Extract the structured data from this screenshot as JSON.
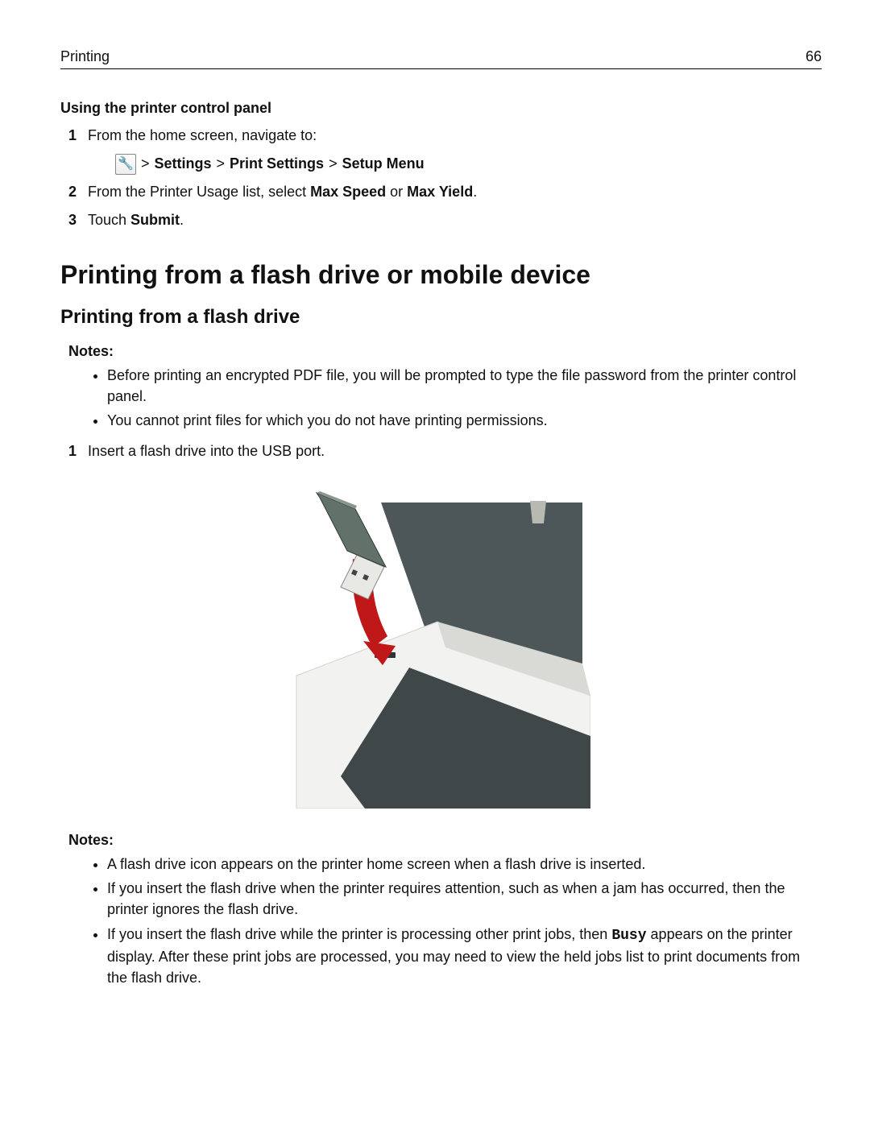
{
  "header": {
    "section": "Printing",
    "page_number": "66"
  },
  "section1": {
    "title": "Using the printer control panel",
    "step1": "From the home screen, navigate to:",
    "breadcrumb_gt1": ">",
    "breadcrumb_b1": "Settings",
    "breadcrumb_gt2": ">",
    "breadcrumb_b2": "Print Settings",
    "breadcrumb_gt3": ">",
    "breadcrumb_b3": "Setup Menu",
    "step2_pre": "From the Printer Usage list, select ",
    "step2_b1": "Max Speed",
    "step2_mid": " or ",
    "step2_b2": "Max Yield",
    "step2_post": ".",
    "step3_pre": "Touch ",
    "step3_b": "Submit",
    "step3_post": "."
  },
  "h1": "Printing from a flash drive or mobile device",
  "h2": "Printing from a flash drive",
  "notes1": {
    "label": "Notes:",
    "b1": "Before printing an encrypted PDF file, you will be prompted to type the file password from the printer control panel.",
    "b2": "You cannot print files for which you do not have printing permissions."
  },
  "step_flash": "Insert a flash drive into the USB port.",
  "notes2": {
    "label": "Notes:",
    "b1": "A flash drive icon appears on the printer home screen when a flash drive is inserted.",
    "b2": "If you insert the flash drive when the printer requires attention, such as when a jam has occurred, then the printer ignores the flash drive.",
    "b3_pre": "If you insert the flash drive while the printer is processing other print jobs, then ",
    "b3_busy": "Busy",
    "b3_post": " appears on the printer display. After these print jobs are processed, you may need to view the held jobs list to print documents from the flash drive."
  },
  "icons": {
    "wrench_glyph": "🔧"
  }
}
